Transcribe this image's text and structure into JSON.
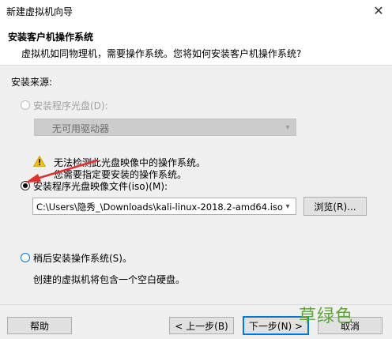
{
  "window": {
    "title": "新建虚拟机向导"
  },
  "header": {
    "title": "安装客户机操作系统",
    "subtitle": "虚拟机如同物理机，需要操作系统。您将如何安装客户机操作系统?"
  },
  "install_source": {
    "label": "安装来源:",
    "disc_option": {
      "label": "安装程序光盘(D):",
      "selected": false,
      "enabled": false,
      "drive_value": "无可用驱动器"
    },
    "iso_option": {
      "label": "安装程序光盘映像文件(iso)(M):",
      "selected": true,
      "path_value": "C:\\Users\\隐秀_\\Downloads\\kali-linux-2018.2-amd64.iso",
      "browse_label": "浏览(R)...",
      "warning_line1": "无法检测此光盘映像中的操作系统。",
      "warning_line2": "您需要指定要安装的操作系统。"
    },
    "later_option": {
      "label": "稍后安装操作系统(S)。",
      "selected": false,
      "description": "创建的虚拟机将包含一个空白硬盘。"
    }
  },
  "footer": {
    "help": "帮助",
    "back": "< 上一步(B)",
    "next": "下一步(N) >",
    "cancel": "取消"
  },
  "watermark": "草绿色",
  "colors": {
    "accent": "#0078d7",
    "annotation_arrow": "#e03030",
    "watermark": "#5fa53a",
    "warning": "#f2c200"
  }
}
